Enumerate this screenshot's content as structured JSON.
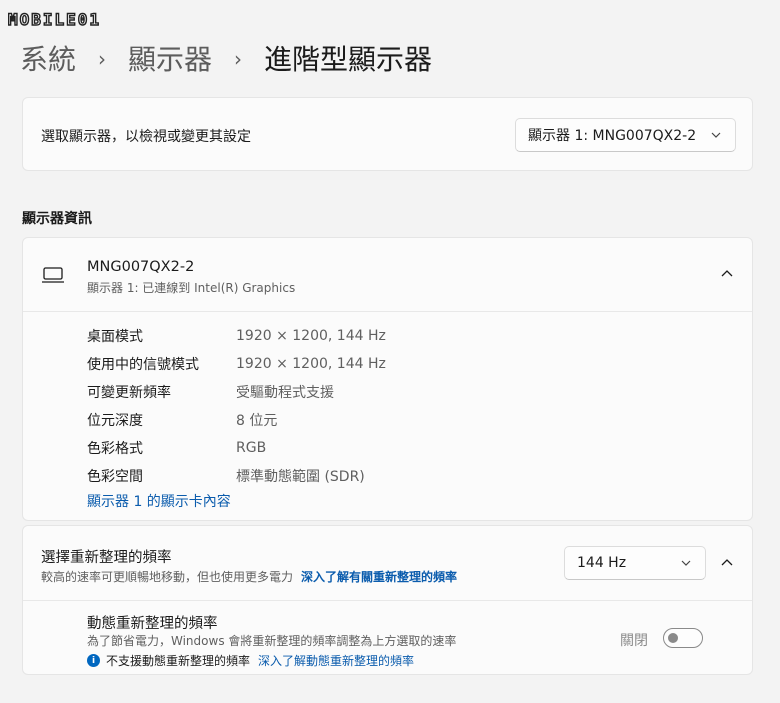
{
  "watermark": {
    "text": "MOBILE01"
  },
  "breadcrumb": {
    "items": [
      "系統",
      "顯示器",
      "進階型顯示器"
    ],
    "separator": "›"
  },
  "display_select": {
    "label": "選取顯示器，以檢視或變更其設定",
    "selected": "顯示器 1: MNG007QX2-2"
  },
  "section_title": "顯示器資訊",
  "monitor": {
    "name": "MNG007QX2-2",
    "subtitle": "顯示器 1: 已連線到 Intel(R) Graphics",
    "icon": "laptop-icon",
    "rows": [
      {
        "key": "桌面模式",
        "value": "1920 × 1200, 144 Hz"
      },
      {
        "key": "使用中的信號模式",
        "value": "1920 × 1200, 144 Hz"
      },
      {
        "key": "可變更新頻率",
        "value": "受驅動程式支援"
      },
      {
        "key": "位元深度",
        "value": "8 位元"
      },
      {
        "key": "色彩格式",
        "value": "RGB"
      },
      {
        "key": "色彩空間",
        "value": "標準動態範圍 (SDR)"
      }
    ],
    "adapter_link": "顯示器 1 的顯示卡內容"
  },
  "refresh_rate": {
    "title": "選擇重新整理的頻率",
    "description": "較高的速率可更順暢地移動，但也使用更多電力",
    "learn_more": "深入了解有關重新整理的頻率",
    "selected": "144 Hz"
  },
  "dynamic_refresh": {
    "title": "動態重新整理的頻率",
    "description": "為了節省電力，Windows 會將重新整理的頻率調整為上方選取的速率",
    "warning": "不支援動態重新整理的頻率",
    "warning_link": "深入了解動態重新整理的頻率",
    "toggle_label": "關閉",
    "toggle_on": false
  },
  "colors": {
    "accent": "#0067c0",
    "link": "#0b5cad",
    "background": "#f3f3f3",
    "card": "#fbfbfb"
  }
}
